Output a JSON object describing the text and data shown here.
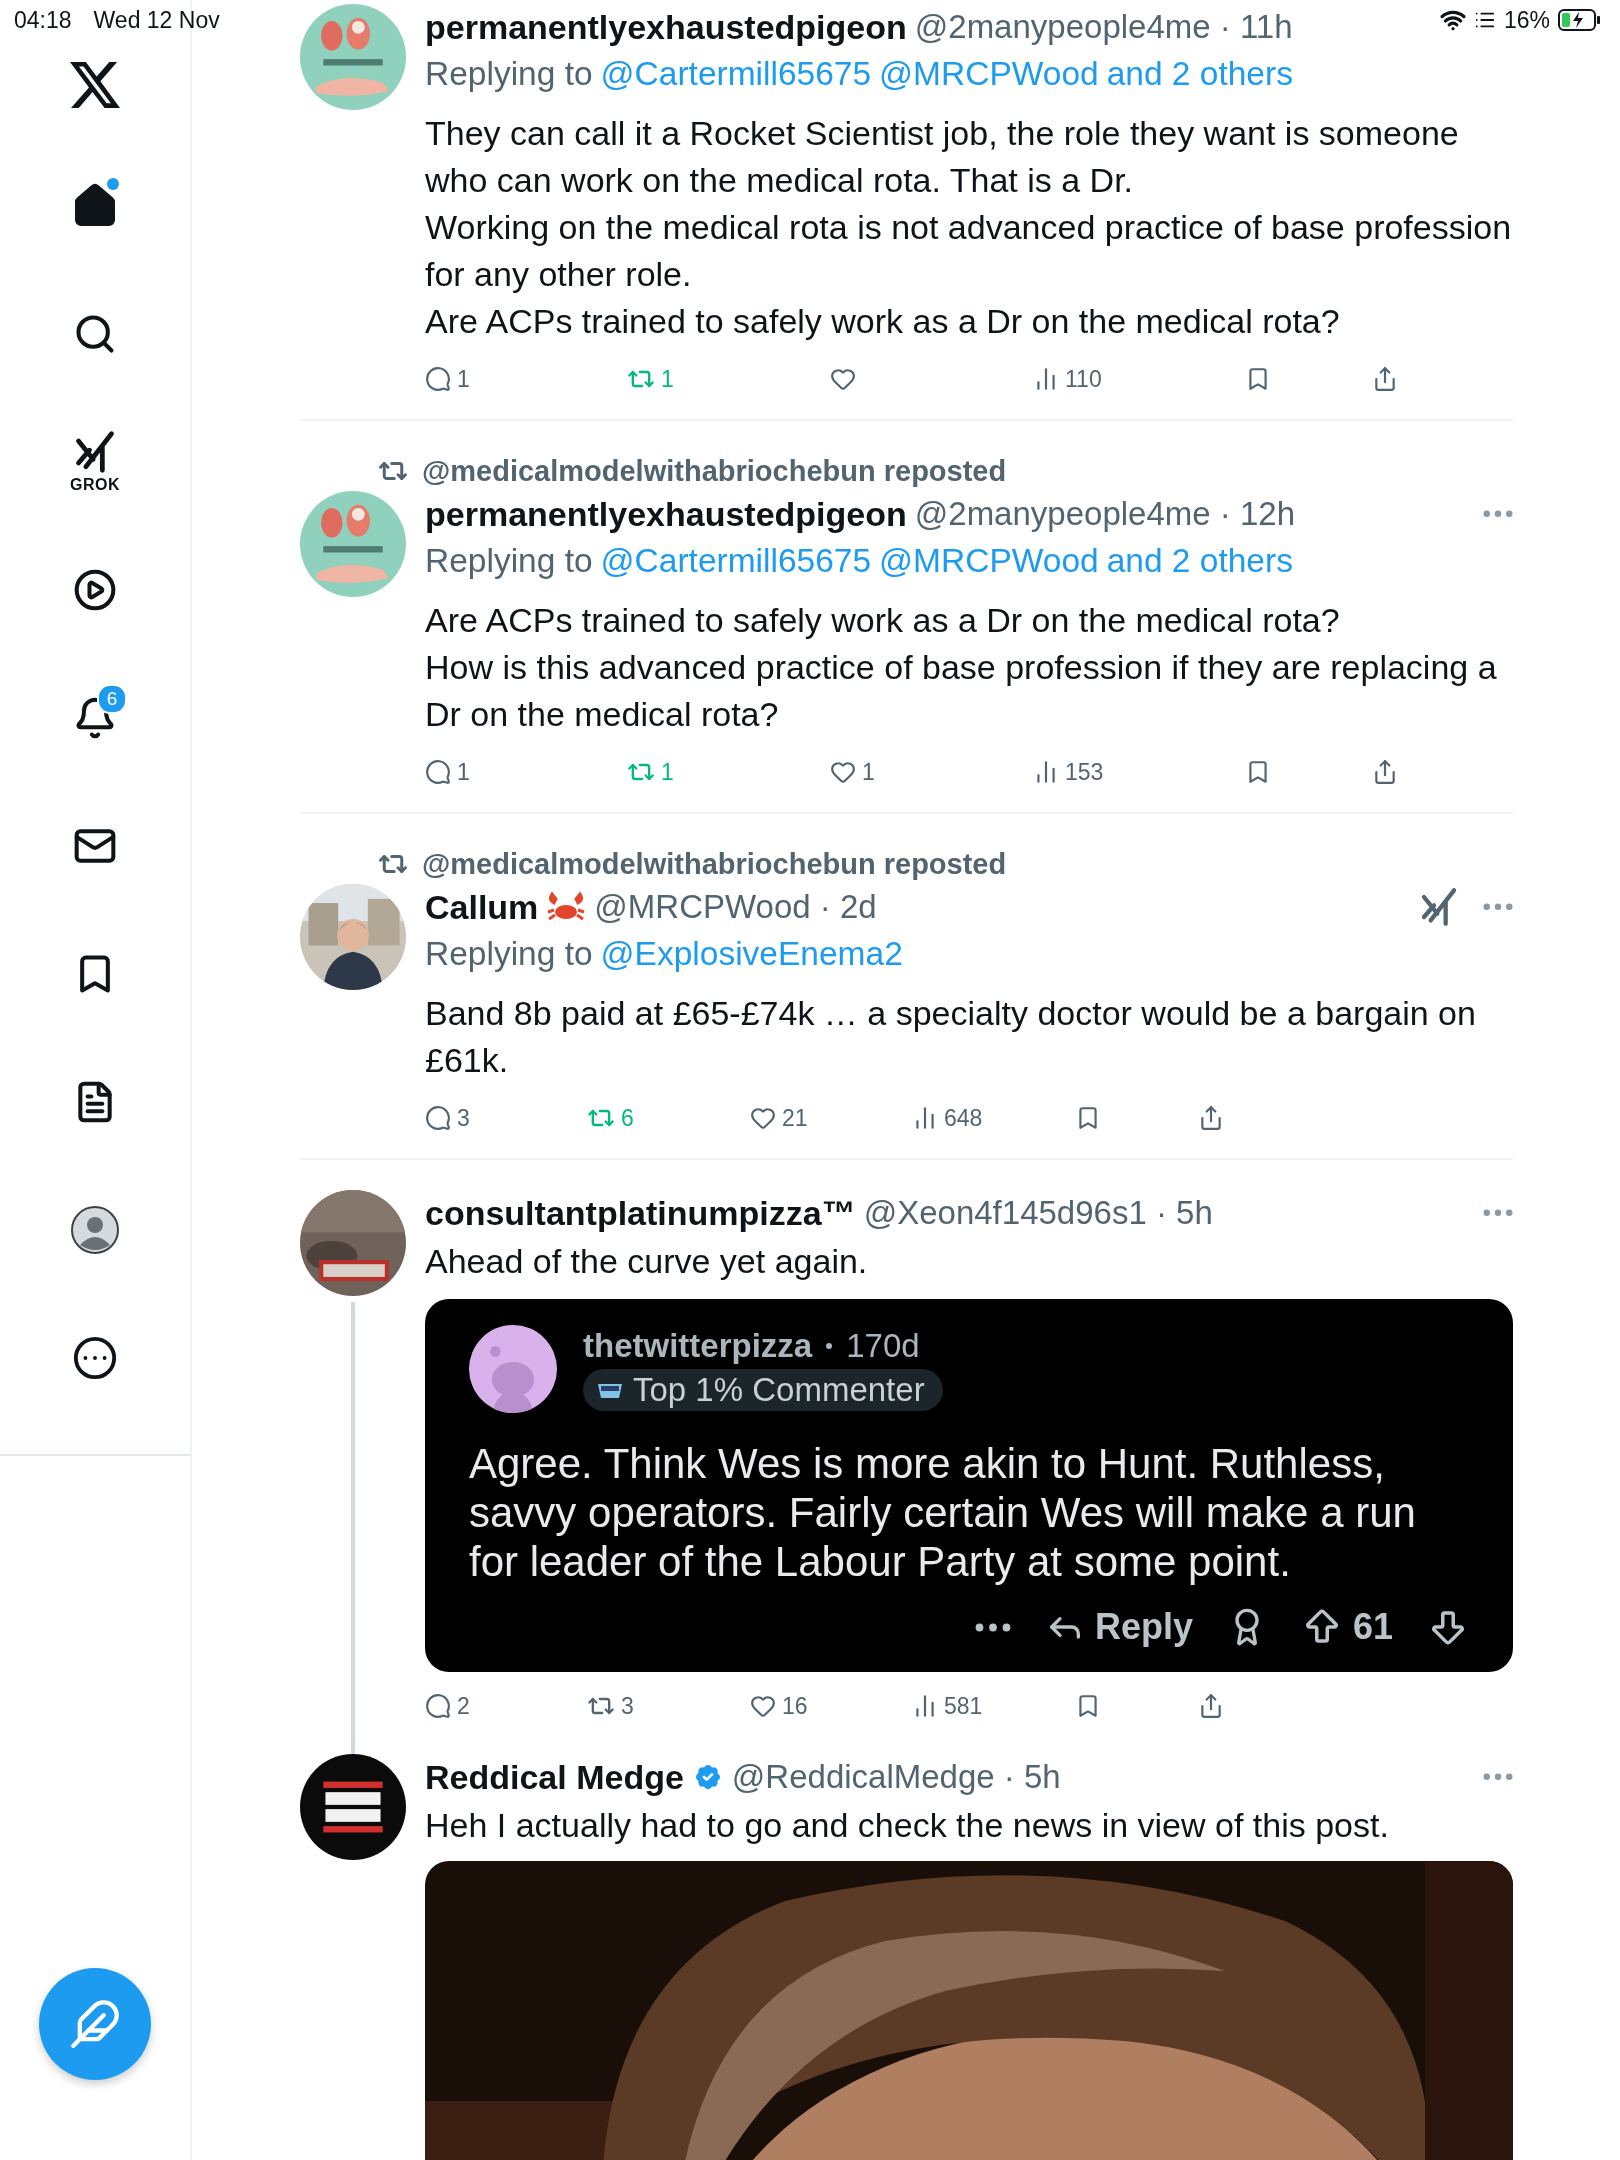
{
  "status_bar": {
    "time": "04:18",
    "date": "Wed 12 Nov",
    "battery": "16%"
  },
  "sidebar": {
    "items": [
      {
        "kind": "home",
        "selected": true,
        "has_dot": true
      },
      {
        "kind": "search",
        "selected": false
      },
      {
        "kind": "grok",
        "selected": false,
        "label": "GROK"
      },
      {
        "kind": "video",
        "selected": false
      },
      {
        "kind": "notifications",
        "selected": false,
        "badge": "6"
      },
      {
        "kind": "messages",
        "selected": false
      },
      {
        "kind": "bookmarks",
        "selected": false
      },
      {
        "kind": "lists",
        "selected": false
      },
      {
        "kind": "profile",
        "selected": false
      },
      {
        "kind": "more",
        "selected": false
      }
    ]
  },
  "tweets": [
    {
      "name": "permanentlyexhaustedpigeon",
      "handle_time": "@2manypeople4me · 11h",
      "more_button": false,
      "replying_label": "Replying to",
      "replying_to": [
        "@Cartermill65675",
        "@MRCPWood",
        "and 2 others"
      ],
      "body": [
        "They can call it a Rocket Scientist job, the role they want is someone who can work on the medical rota. That is a Dr.",
        "Working on the medical rota is not advanced practice of base profession for any other role.",
        "Are ACPs trained to safely work as a Dr on the medical rota?"
      ],
      "stats": {
        "replies": "1",
        "reposts": "1",
        "views": "110",
        "reposted": true
      }
    },
    {
      "reposted_by": "@medicalmodelwithabriochebun reposted",
      "name": "permanentlyexhaustedpigeon",
      "handle_time": "@2manypeople4me · 12h",
      "more_button": true,
      "replying_label": "Replying to",
      "replying_to": [
        "@Cartermill65675",
        "@MRCPWood",
        "and 2 others"
      ],
      "body": [
        "Are ACPs trained to safely work as a Dr on the medical rota?",
        "How is this advanced practice of base profession if they are replacing a Dr on the medical rota?"
      ],
      "stats": {
        "replies": "1",
        "reposts": "1",
        "likes": "1",
        "views": "153",
        "reposted": true
      }
    },
    {
      "reposted_by": "@medicalmodelwithabriochebun reposted",
      "name": "Callum",
      "name_icon": {
        "kind": "crab"
      },
      "handle_time": "@MRCPWood · 2d",
      "more_button": true,
      "grok_button": true,
      "replying_label": "Replying to",
      "replying_to": [
        "@ExplosiveEnema2"
      ],
      "body": [
        "Band 8b paid at £65-£74k …  a specialty doctor would be a bargain on £61k."
      ],
      "stats": {
        "replies": "3",
        "reposts": "6",
        "likes": "21",
        "views": "648",
        "reposted": true
      }
    },
    {
      "name": "consultantplatinumpizza™",
      "handle_time": "@Xeon4f145d96s1 · 5h",
      "more_button": true,
      "connected_below": true,
      "body": [
        "Ahead of the curve yet again."
      ],
      "embed": {
        "username": "thetwitterpizza",
        "age": "170d",
        "badge": "Top 1% Commenter",
        "body": "Agree. Think Wes is more akin to Hunt. Ruthless, savvy operators. Fairly certain Wes will make a run for leader of the Labour Party at some point.",
        "reply": "Reply",
        "score": "61"
      },
      "stats": {
        "replies": "2",
        "reposts": "3",
        "likes": "16",
        "views": "581",
        "reposted": false
      }
    },
    {
      "name": "Reddical Medge",
      "verified": true,
      "handle_time": "@ReddicalMedge · 5h",
      "more_button": true,
      "body": [
        "Heh I actually had to go and check the news in view of this post."
      ],
      "media": {
        "kind": "picture"
      }
    }
  ]
}
